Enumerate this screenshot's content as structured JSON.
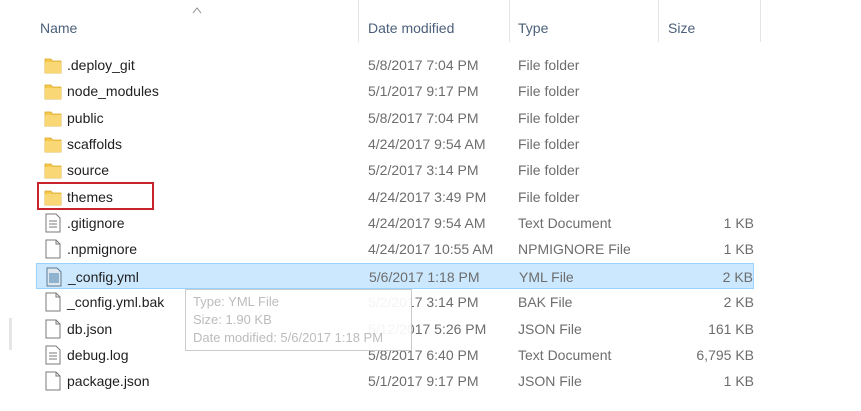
{
  "columns": {
    "name": "Name",
    "date": "Date modified",
    "type": "Type",
    "size": "Size"
  },
  "files": [
    {
      "name": ".deploy_git",
      "date": "5/8/2017 7:04 PM",
      "type": "File folder",
      "size": "",
      "icon": "folder-icon"
    },
    {
      "name": "node_modules",
      "date": "5/1/2017 9:17 PM",
      "type": "File folder",
      "size": "",
      "icon": "folder-icon"
    },
    {
      "name": "public",
      "date": "5/8/2017 7:04 PM",
      "type": "File folder",
      "size": "",
      "icon": "folder-icon"
    },
    {
      "name": "scaffolds",
      "date": "4/24/2017 9:54 AM",
      "type": "File folder",
      "size": "",
      "icon": "folder-icon"
    },
    {
      "name": "source",
      "date": "5/2/2017 3:14 PM",
      "type": "File folder",
      "size": "",
      "icon": "folder-icon"
    },
    {
      "name": "themes",
      "date": "4/24/2017 3:49 PM",
      "type": "File folder",
      "size": "",
      "icon": "folder-icon"
    },
    {
      "name": ".gitignore",
      "date": "4/24/2017 9:54 AM",
      "type": "Text Document",
      "size": "1 KB",
      "icon": "text-file-icon"
    },
    {
      "name": ".npmignore",
      "date": "4/24/2017 10:55 AM",
      "type": "NPMIGNORE File",
      "size": "1 KB",
      "icon": "blank-file-icon"
    },
    {
      "name": "_config.yml",
      "date": "5/6/2017 1:18 PM",
      "type": "YML File",
      "size": "2 KB",
      "icon": "yml-file-icon"
    },
    {
      "name": "_config.yml.bak",
      "date": "5/2/2017 3:14 PM",
      "type": "BAK File",
      "size": "2 KB",
      "icon": "blank-file-icon"
    },
    {
      "name": "db.json",
      "date": "5/12/2017 5:26 PM",
      "type": "JSON File",
      "size": "161 KB",
      "icon": "blank-file-icon"
    },
    {
      "name": "debug.log",
      "date": "5/8/2017 6:40 PM",
      "type": "Text Document",
      "size": "6,795 KB",
      "icon": "text-file-icon"
    },
    {
      "name": "package.json",
      "date": "5/1/2017 9:17 PM",
      "type": "JSON File",
      "size": "1 KB",
      "icon": "blank-file-icon"
    }
  ],
  "selected_file": "_config.yml",
  "highlighted_file": "themes",
  "tooltip": {
    "type_line": "Type: YML File",
    "size_line": "Size: 1.90 KB",
    "date_line": "Date modified: 5/6/2017 1:18 PM"
  },
  "colors": {
    "selection_bg": "#cce8ff",
    "selection_border": "#99d1ff",
    "highlight_border": "#c9242b",
    "folder": "#f4c94c",
    "header_text": "#4c607a"
  }
}
